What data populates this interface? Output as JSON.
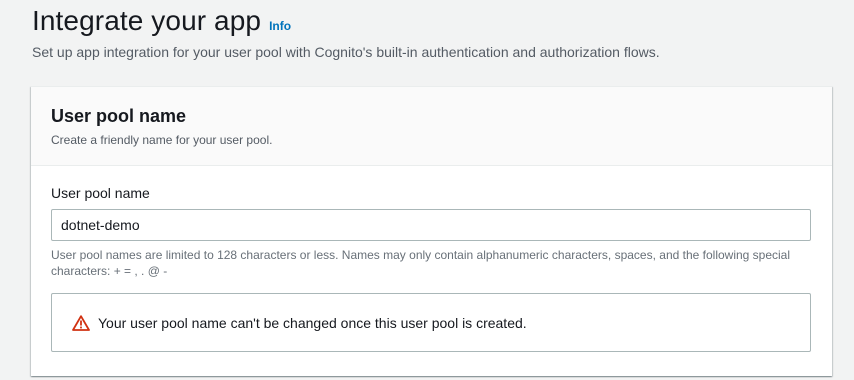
{
  "page": {
    "title": "Integrate your app",
    "info_label": "Info",
    "description": "Set up app integration for your user pool with Cognito's built-in authentication and authorization flows."
  },
  "section": {
    "title": "User pool name",
    "description": "Create a friendly name for your user pool.",
    "field": {
      "label": "User pool name",
      "value": "dotnet-demo",
      "constraint": "User pool names are limited to 128 characters or less. Names may only contain alphanumeric characters, spaces, and the following special characters: + = , . @ -"
    },
    "alert": {
      "icon": "warning-icon",
      "text": "Your user pool name can't be changed once this user pool is created."
    }
  },
  "colors": {
    "link": "#0073bb",
    "warning": "#d13212"
  }
}
